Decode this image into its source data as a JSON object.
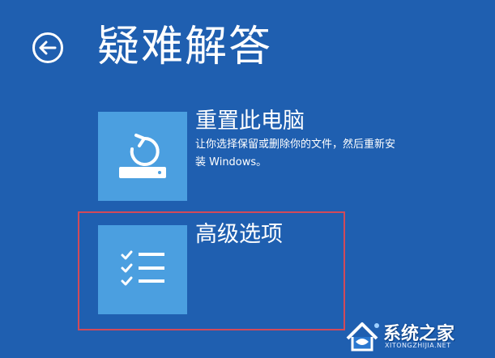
{
  "header": {
    "title": "疑难解答",
    "back_icon": "arrow-left-circle-icon"
  },
  "options": [
    {
      "title": "重置此电脑",
      "description": "让你选择保留或删除你的文件，然后重新安装 Windows。",
      "icon": "reset-pc-icon"
    },
    {
      "title": "高级选项",
      "description": "",
      "icon": "checklist-icon"
    }
  ],
  "watermark": {
    "text": "系统之家",
    "url": "XITONGZHIJIA.NET",
    "icon": "house-logo-icon"
  },
  "colors": {
    "background": "#1f5fb0",
    "tile": "#4b9fe0",
    "highlight": "#d14a5a",
    "text": "#ffffff"
  }
}
